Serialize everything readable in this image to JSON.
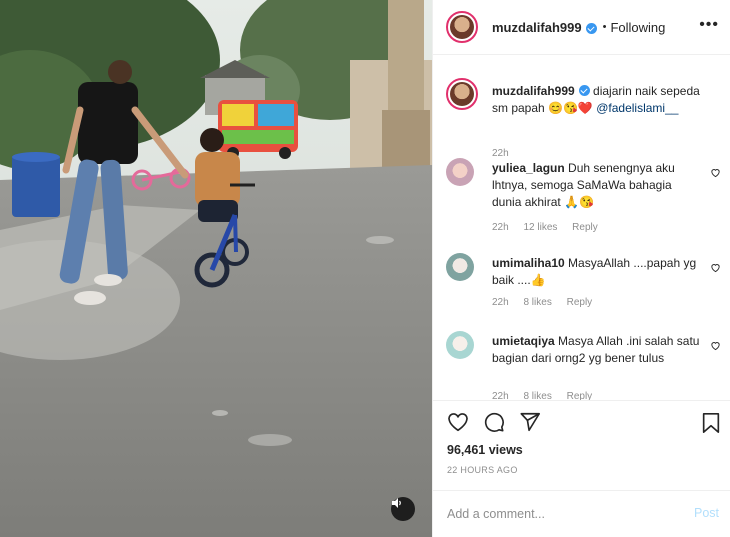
{
  "post": {
    "username": "muzdalifah999",
    "follow_status": "Following",
    "more_label": "•••",
    "caption_text": "diajarin naik sepeda sm papah 😊😘❤️",
    "caption_mention": "@fadelislami__",
    "caption_time": "22h"
  },
  "comments": [
    {
      "username": "yuliea_lagun",
      "text": "Duh senengnya aku lhtnya, semoga SaMaWa bahagia dunia akhirat 🙏😘",
      "time": "22h",
      "likes": "12 likes",
      "reply": "Reply"
    },
    {
      "username": "umimaliha10",
      "text": "MasyaAllah ....papah yg baik ....👍",
      "time": "22h",
      "likes": "8 likes",
      "reply": "Reply"
    },
    {
      "username": "umietaqiya",
      "text": "Masya Allah .ini salah satu bagian dari orng2 yg bener tulus",
      "time": "22h",
      "likes": "8 likes",
      "reply": "Reply"
    }
  ],
  "stats": {
    "views": "96,461 views",
    "time_ago": "22 HOURS AGO"
  },
  "add_comment": {
    "placeholder": "Add a comment...",
    "post_label": "Post"
  },
  "colors": {
    "link": "#00376b",
    "verified": "#3897f0",
    "post_button_disabled": "#b2dffc",
    "muted_text": "#8e8e8e"
  }
}
